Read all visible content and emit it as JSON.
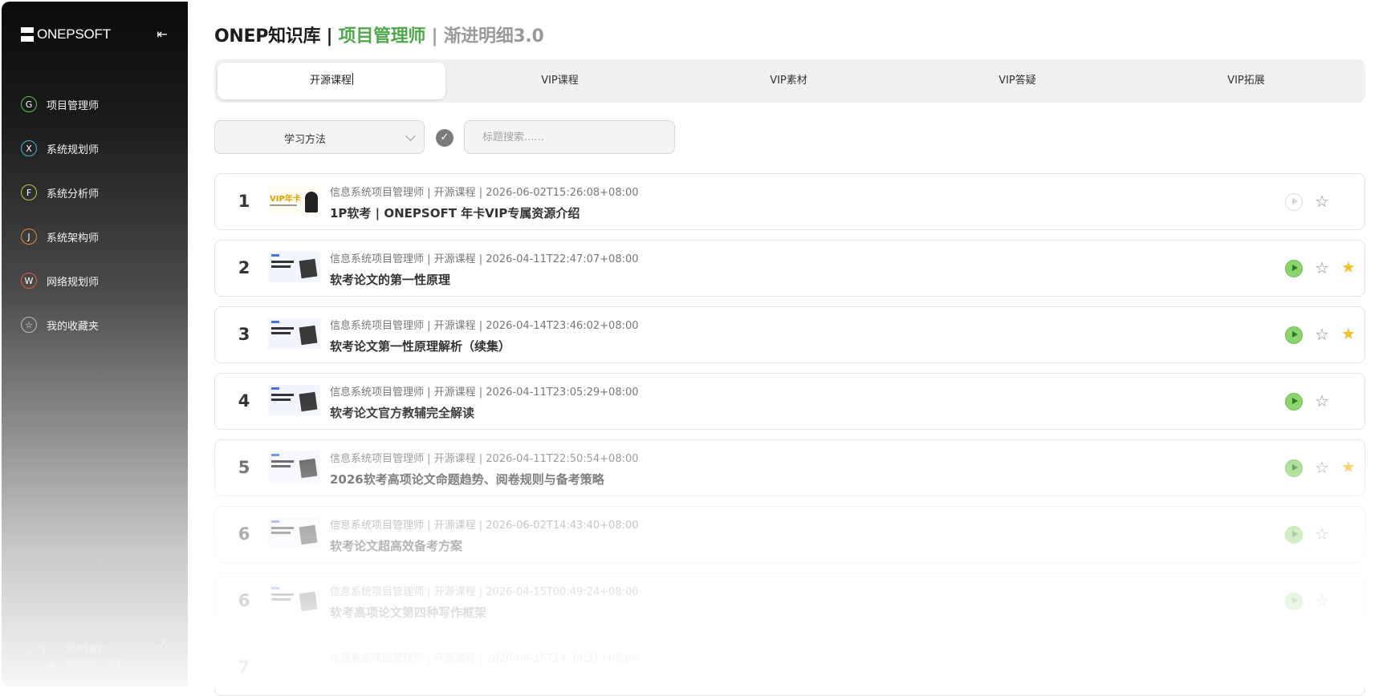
{
  "sidebar": {
    "logo": "ONEPSOFT",
    "collapse_icon": "collapse-left-icon",
    "items": [
      {
        "letter": "G",
        "label": "项目管理师",
        "color": "#5fbf4a"
      },
      {
        "letter": "X",
        "label": "系统规划师",
        "color": "#3fb5c9"
      },
      {
        "letter": "F",
        "label": "系统分析师",
        "color": "#c9c23a"
      },
      {
        "letter": "J",
        "label": "系统架构师",
        "color": "#e08a3c"
      },
      {
        "letter": "W",
        "label": "网络规划师",
        "color": "#e05a4a"
      },
      {
        "letter": "☆",
        "label": "我的收藏夹",
        "color": "#bbbbbb"
      }
    ],
    "user": {
      "name": "Peter",
      "phone": "888887701"
    }
  },
  "header": {
    "title_part1": "ONEP知识库 | ",
    "title_part2": "项目管理师",
    "title_part3": " | 渐进明细3.0"
  },
  "tabs": [
    "开源课程",
    "VIP课程",
    "VIP素材",
    "VIP答疑",
    "VIP拓展"
  ],
  "active_tab": 0,
  "filters": {
    "category": "学习方法",
    "search_placeholder": "标题搜索......"
  },
  "items": [
    {
      "index": "1",
      "meta": "信息系统项目管理师 | 开源课程 | 2026-06-02T15:26:08+08:00",
      "title": "1P软考 | ONEPSOFT 年卡VIP专属资源介绍",
      "thumb_text": "VIP年卡",
      "playable": false,
      "starred": false
    },
    {
      "index": "2",
      "meta": "信息系统项目管理师 | 开源课程 | 2026-04-11T22:47:07+08:00",
      "title": "软考论文的第一性原理",
      "playable": true,
      "starred": true
    },
    {
      "index": "3",
      "meta": "信息系统项目管理师 | 开源课程 | 2026-04-14T23:46:02+08:00",
      "title": "软考论文第一性原理解析（续集）",
      "playable": true,
      "starred": true
    },
    {
      "index": "4",
      "meta": "信息系统项目管理师 | 开源课程 | 2026-04-11T23:05:29+08:00",
      "title": "软考论文官方教辅完全解读",
      "playable": true,
      "starred": false
    },
    {
      "index": "5",
      "meta": "信息系统项目管理师 | 开源课程 | 2026-04-11T22:50:54+08:00",
      "title": "2026软考高项论文命题趋势、阅卷规则与备考策略",
      "playable": true,
      "starred": true
    },
    {
      "index": "6",
      "meta": "信息系统项目管理师 | 开源课程 | 2026-06-02T14:43:40+08:00",
      "title": "软考论文超高效备考方案",
      "playable": true,
      "starred": false
    },
    {
      "index": "6",
      "meta": "信息系统项目管理师 | 开源课程 | 2026-04-15T00:49:24+08:00",
      "title": "软考高项论文第四种写作框架",
      "playable": true,
      "starred": false
    },
    {
      "index": "7",
      "meta": "信息系统项目管理师 | 开源课程 | 2026-04-16T14:39:31+08:00",
      "title": "",
      "playable": true,
      "starred": false
    }
  ]
}
